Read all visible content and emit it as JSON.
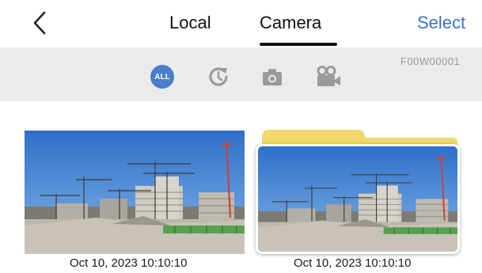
{
  "header": {
    "back_icon": "chevron-left-icon",
    "tabs": [
      {
        "label": "Local",
        "active": false
      },
      {
        "label": "Camera",
        "active": true
      }
    ],
    "select_label": "Select"
  },
  "filter_bar": {
    "device_id": "F00W00001",
    "filters": [
      {
        "icon": "all-icon",
        "label": "ALL",
        "active": true
      },
      {
        "icon": "recent-clock-icon",
        "active": false
      },
      {
        "icon": "camera-icon",
        "active": false
      },
      {
        "icon": "video-camera-icon",
        "active": false
      }
    ]
  },
  "items": [
    {
      "type": "photo",
      "timestamp": "Oct 10, 2023 10:10:10"
    },
    {
      "type": "folder",
      "timestamp": "Oct 10, 2023 10:10:10"
    }
  ],
  "colors": {
    "accent": "#3a72c6",
    "all_badge": "#4a7ecb",
    "filter_bar_bg": "#ebebeb",
    "folder": "#f2d86a"
  }
}
